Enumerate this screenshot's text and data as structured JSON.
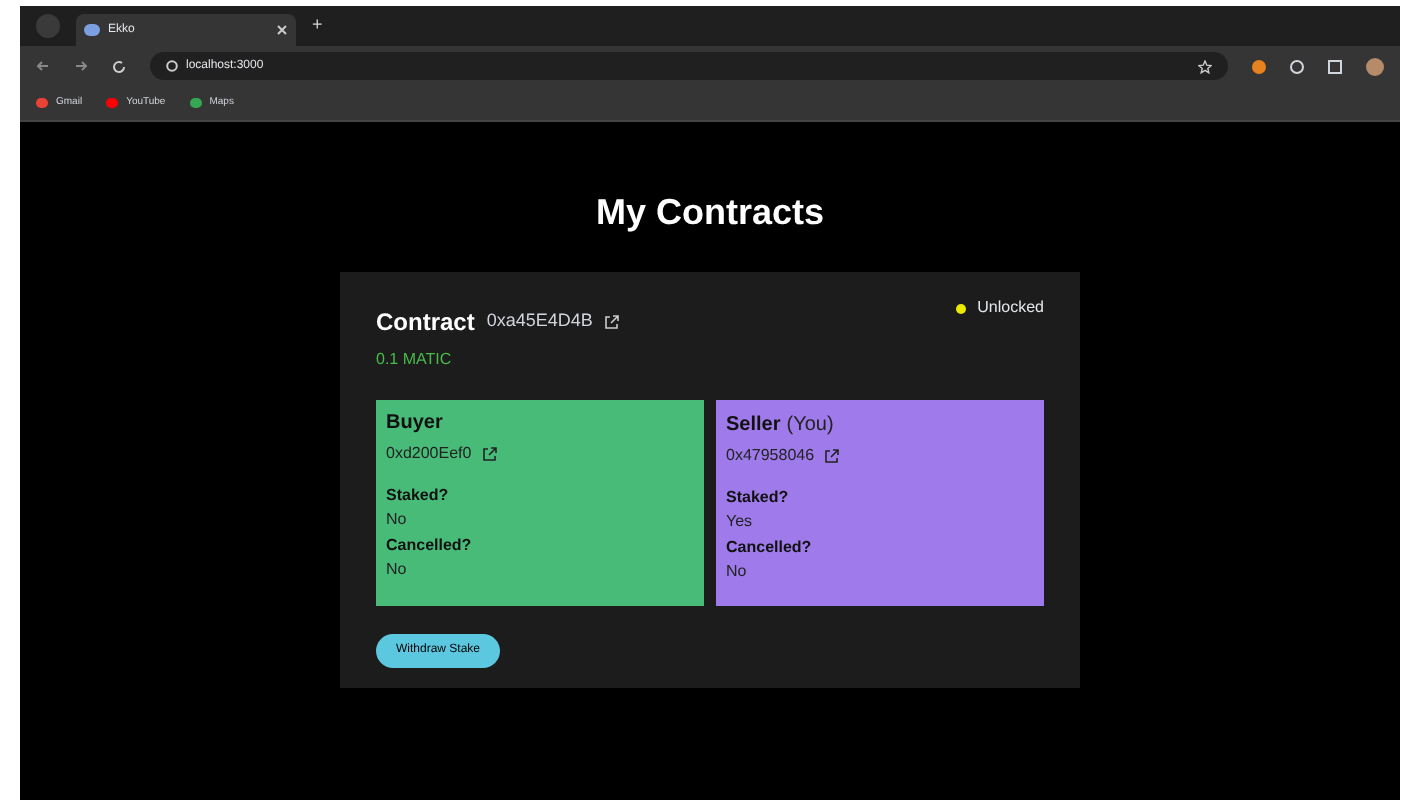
{
  "browser": {
    "tab": {
      "title": "Ekko"
    },
    "new_tab": "+",
    "url": "localhost:3000",
    "bookmarks": [
      {
        "label": "Gmail"
      },
      {
        "label": "YouTube"
      },
      {
        "label": "Maps"
      }
    ]
  },
  "page": {
    "title": "My Contracts"
  },
  "contract": {
    "label": "Contract",
    "address": "0xa45E4D4B",
    "amount": "0.1 MATIC",
    "status": {
      "label": "Unlocked",
      "color": "#eaea00"
    },
    "parties": [
      {
        "role": "Buyer",
        "address": "0xd200Eef0",
        "color": "#48bb78",
        "fields": [
          {
            "label": "Staked?",
            "value": "No"
          },
          {
            "label": "Cancelled?",
            "value": "No"
          }
        ]
      },
      {
        "role": "Seller",
        "note": "(You)",
        "address": "0x47958046",
        "color": "#9f7aea",
        "fields": [
          {
            "label": "Staked?",
            "value": "Yes"
          },
          {
            "label": "Cancelled?",
            "value": "No"
          }
        ]
      }
    ],
    "action": "Withdraw Stake"
  }
}
